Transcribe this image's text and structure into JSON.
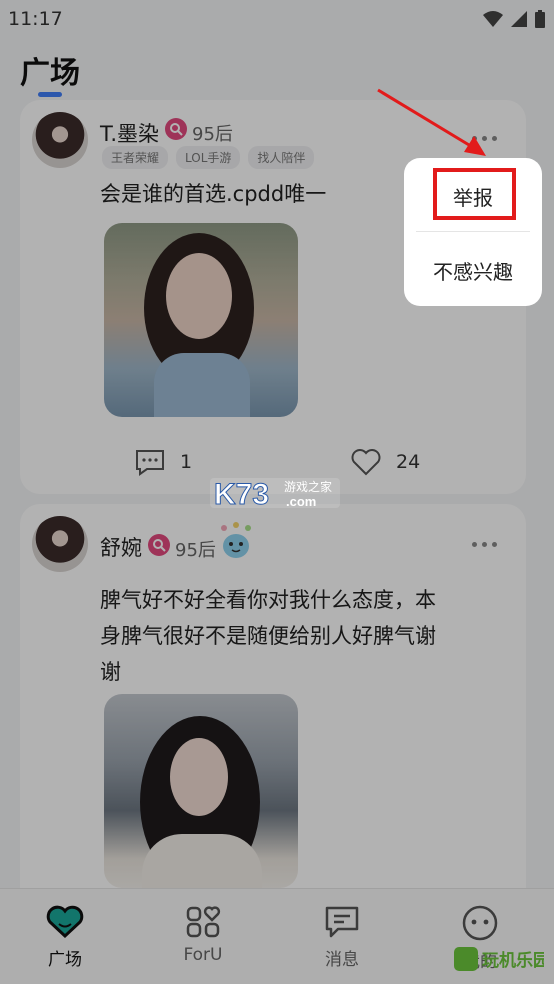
{
  "status_bar": {
    "time": "11:17"
  },
  "header": {
    "title": "广场"
  },
  "posts": [
    {
      "user_name": "T.墨染",
      "age": "95后",
      "tags": [
        "王者荣耀",
        "LOL手游",
        "找人陪伴"
      ],
      "text": "会是谁的首选.cpdd唯一",
      "comments": "1",
      "likes": "24"
    },
    {
      "user_name": "舒婉",
      "age": "95后",
      "text_lines": [
        "脾气好不好全看你对我什么态度，本",
        "身脾气很好不是随便给别人好脾气谢",
        "谢"
      ]
    }
  ],
  "popup_menu": {
    "items": [
      "举报",
      "不感兴趣"
    ]
  },
  "bottom_nav": {
    "items": [
      {
        "label": "广场",
        "icon": "heart-chat-icon"
      },
      {
        "label": "ForU",
        "icon": "grid-heart-icon"
      },
      {
        "label": "消息",
        "icon": "message-icon"
      },
      {
        "label": "我的",
        "icon": "face-icon"
      }
    ]
  },
  "watermark": {
    "brand": "K73",
    "subtitle": "游戏之家",
    "domain": ".com"
  },
  "corner_logo": {
    "text": "玩机乐园"
  },
  "colors": {
    "accent": "#3f7df7",
    "highlight": "#e21b1b",
    "badge": "#e2497e",
    "active_icon": "#1aa89a"
  }
}
